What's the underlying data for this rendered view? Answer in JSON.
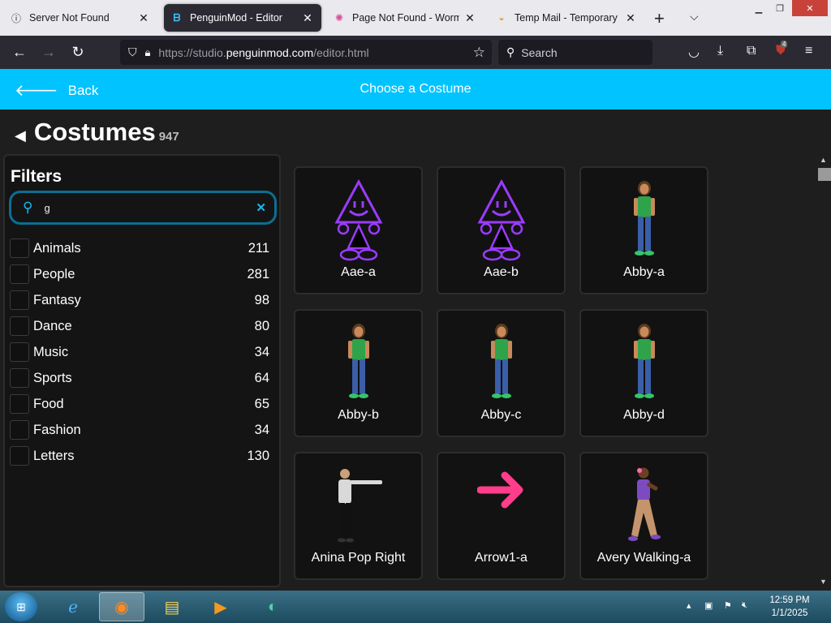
{
  "browser": {
    "tabs": [
      {
        "title": "Server Not Found",
        "active": false
      },
      {
        "title": "PenguinMod - Editor",
        "active": true
      },
      {
        "title": "Page Not Found - Wormho",
        "active": false
      },
      {
        "title": "Temp Mail - Temporary Di",
        "active": false
      }
    ],
    "url_prefix": "https://studio.",
    "url_domain": "penguinmod.com",
    "url_suffix": "/editor.html",
    "search_placeholder": "Search",
    "extension_badge": "4"
  },
  "app": {
    "back_label": "Back",
    "title": "Choose a Costume",
    "accent_color": "#00c3ff"
  },
  "library": {
    "heading": "Costumes",
    "count": "947",
    "filters_title": "Filters",
    "search_value": "g",
    "categories": [
      {
        "name": "Animals",
        "count": "211"
      },
      {
        "name": "People",
        "count": "281"
      },
      {
        "name": "Fantasy",
        "count": "98"
      },
      {
        "name": "Dance",
        "count": "80"
      },
      {
        "name": "Music",
        "count": "34"
      },
      {
        "name": "Sports",
        "count": "64"
      },
      {
        "name": "Food",
        "count": "65"
      },
      {
        "name": "Fashion",
        "count": "34"
      },
      {
        "name": "Letters",
        "count": "130"
      }
    ],
    "items": [
      {
        "name": "Aae-a",
        "art": "triangle"
      },
      {
        "name": "Aae-b",
        "art": "triangle"
      },
      {
        "name": "Abby-a",
        "art": "girl"
      },
      {
        "name": "Abby-b",
        "art": "girl"
      },
      {
        "name": "Abby-c",
        "art": "girl"
      },
      {
        "name": "Abby-d",
        "art": "girl"
      },
      {
        "name": "Anina Pop Right",
        "art": "dancer"
      },
      {
        "name": "Arrow1-a",
        "art": "arrow"
      },
      {
        "name": "Avery Walking-a",
        "art": "walker"
      }
    ]
  },
  "taskbar": {
    "time": "12:59 PM",
    "date": "1/1/2025"
  }
}
